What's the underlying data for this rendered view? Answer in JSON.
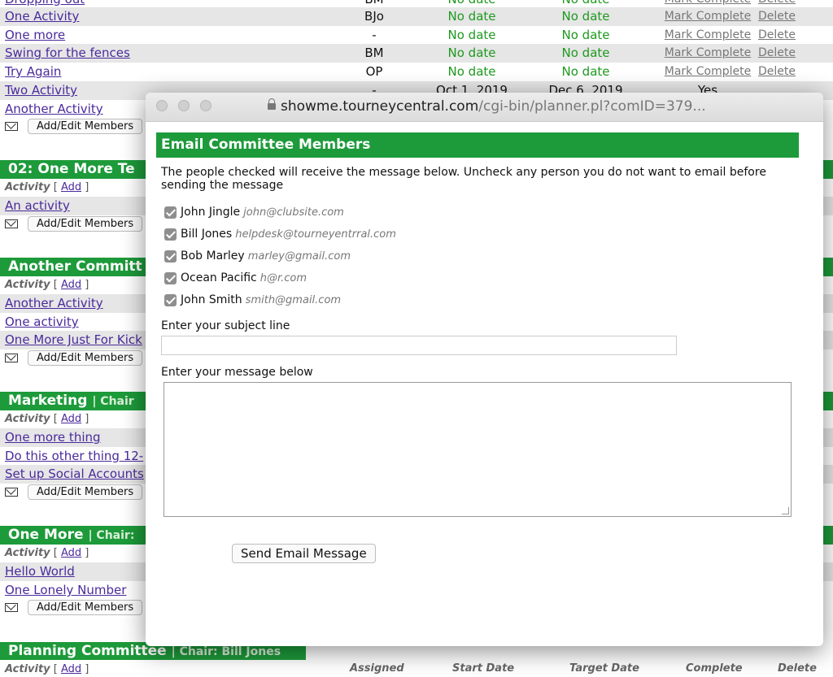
{
  "top_rows": [
    {
      "name": "Dropping out",
      "assigned": "BM",
      "start": "No date",
      "target": "No date",
      "mark": "Mark Complete",
      "delete": "Delete"
    },
    {
      "name": "One Activity",
      "assigned": "BJo",
      "start": "No date",
      "target": "No date",
      "mark": "Mark Complete",
      "delete": "Delete"
    },
    {
      "name": "One more",
      "assigned": "-",
      "start": "No date",
      "target": "No date",
      "mark": "Mark Complete",
      "delete": "Delete"
    },
    {
      "name": "Swing for the fences",
      "assigned": "BM",
      "start": "No date",
      "target": "No date",
      "mark": "Mark Complete",
      "delete": "Delete"
    },
    {
      "name": "Try Again",
      "assigned": "OP",
      "start": "No date",
      "target": "No date",
      "mark": "Mark Complete",
      "delete": "Delete"
    },
    {
      "name": "Two Activity",
      "assigned": "-",
      "start": "Oct 1, 2019",
      "target": "Dec 6, 2019",
      "complete": "Yes"
    }
  ],
  "background": {
    "another_activity_1": "Another Activity",
    "add_edit_members": "Add/Edit Members",
    "committee_02": "02: One More Te",
    "activity_label": "Activity",
    "add_label": "Add",
    "an_activity": "An activity",
    "another_committee": "Another Committ",
    "another_activity_2": "Another Activity",
    "one_activity": "One activity",
    "one_more_kick": "One More Just For Kick",
    "marketing": "Marketing",
    "marketing_chair": "| Chair",
    "one_more_thing": "One more thing",
    "do_this": "Do this other thing 12-",
    "social": "Set up Social Accounts",
    "one_more_committee": "One More",
    "one_more_chair": "| Chair:",
    "hello_world": "Hello World",
    "lonely": "One Lonely Number",
    "planning": "Planning Committee",
    "planning_chair": "| Chair: Bill Jones",
    "col_assigned": "Assigned",
    "col_start": "Start Date",
    "col_target": "Target Date",
    "col_complete": "Complete",
    "col_delete": "Delete"
  },
  "popup": {
    "url_host": "showme.tourneycentral.com",
    "url_path": "/cgi-bin/planner.pl?comID=379...",
    "heading": "Email Committee Members",
    "instructions": "The people checked will receive the message below. Uncheck any person you do not want to email before sending the message",
    "members": [
      {
        "name": "John Jingle",
        "email": "john@clubsite.com"
      },
      {
        "name": "Bill Jones",
        "email": "helpdesk@tourneyentrral.com"
      },
      {
        "name": "Bob Marley",
        "email": "marley@gmail.com"
      },
      {
        "name": "Ocean Pacific",
        "email": "h@r.com"
      },
      {
        "name": "John Smith",
        "email": "smith@gmail.com"
      }
    ],
    "subject_label": "Enter your subject line",
    "message_label": "Enter your message below",
    "send_label": "Send Email Message"
  }
}
